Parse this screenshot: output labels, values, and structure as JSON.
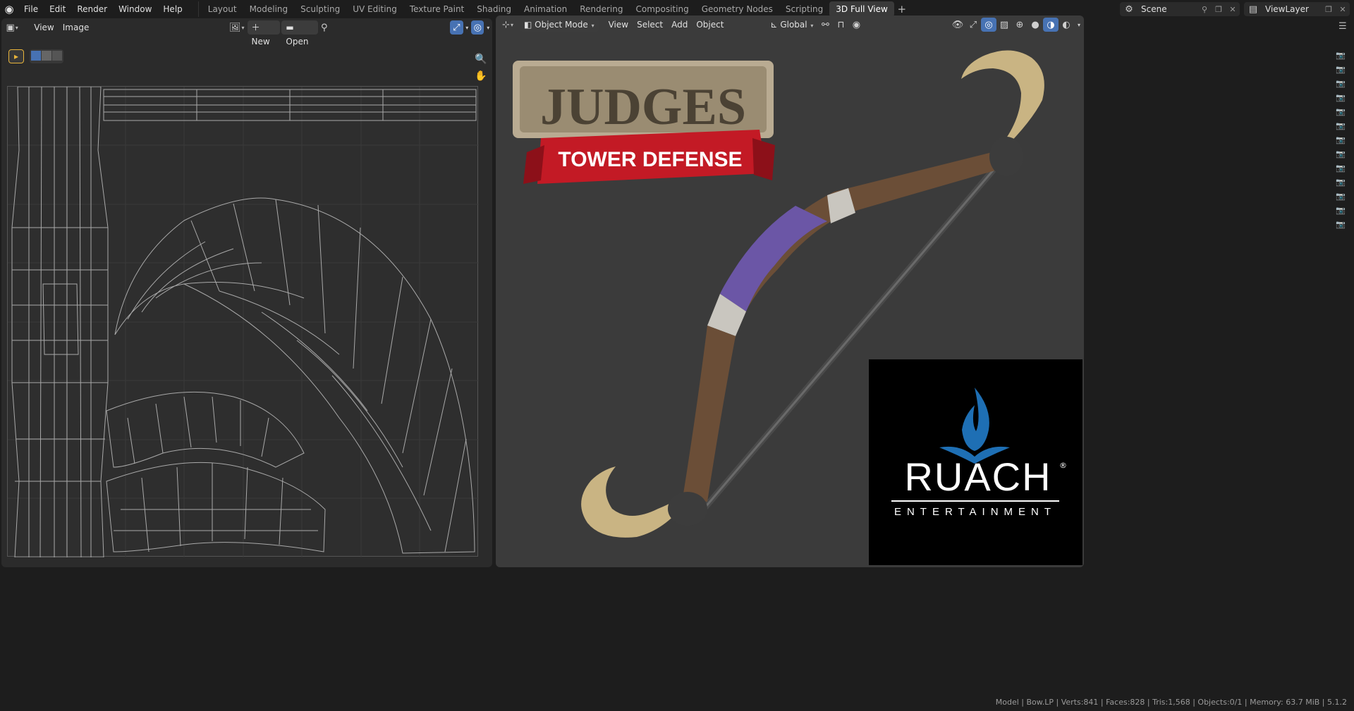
{
  "app": {
    "name": "Blender"
  },
  "topbar": {
    "menu": [
      "File",
      "Edit",
      "Render",
      "Window",
      "Help"
    ],
    "workspaces": [
      "Layout",
      "Modeling",
      "Sculpting",
      "UV Editing",
      "Texture Paint",
      "Shading",
      "Animation",
      "Rendering",
      "Compositing",
      "Geometry Nodes",
      "Scripting",
      "3D Full View"
    ],
    "active_workspace": "3D Full View",
    "scene": "Scene",
    "view_layer": "ViewLayer"
  },
  "uv_editor": {
    "menu": [
      "View",
      "Image"
    ],
    "new_label": "New",
    "open_label": "Open"
  },
  "viewport": {
    "mode": "Object Mode",
    "menu": [
      "View",
      "Select",
      "Add",
      "Object"
    ],
    "orientation": "Global"
  },
  "overlay_logos": {
    "game_title": "JUDGES",
    "game_subtitle": "TOWER DEFENSE",
    "studio_name": "RUACH",
    "studio_registered": "®",
    "studio_subtitle": "ENTERTAINMENT"
  },
  "statusbar": {
    "text": "Model | Bow.LP | Verts:841 | Faces:828 | Tris:1,568 | Objects:0/1 | Memory: 63.7 MiB | 5.1.2"
  },
  "colors": {
    "accent": "#4772b3",
    "bow_wood": "#6b4e37",
    "bow_wrap_purple": "#6b56a6",
    "bow_tip": "#c9b483",
    "banner_red": "#c31a25"
  }
}
